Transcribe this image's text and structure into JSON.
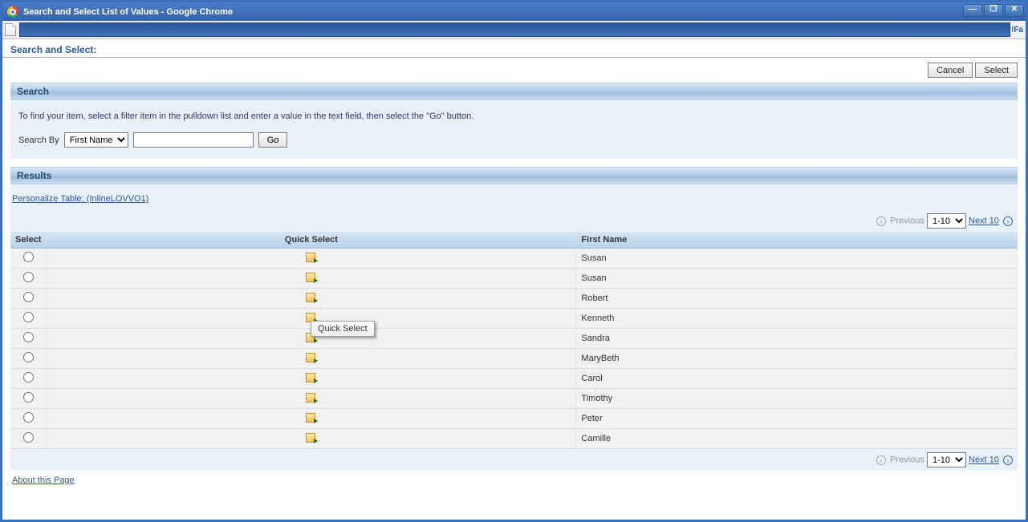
{
  "window": {
    "title": "Search and Select List of Values - Google Chrome",
    "addr_right": "!Fa"
  },
  "header": {
    "title": "Search and Select:"
  },
  "actions": {
    "cancel": "Cancel",
    "select": "Select"
  },
  "search": {
    "section_title": "Search",
    "help": "To find your item, select a filter item in the pulldown list and enter a value in the text field, then select the \"Go\" button.",
    "by_label": "Search By",
    "by_value": "First Name",
    "input_value": "",
    "go": "Go"
  },
  "results": {
    "section_title": "Results",
    "personalize": "Personalize Table: (InlineLOVVO1)",
    "columns": {
      "select": "Select",
      "quick_select": "Quick Select",
      "first_name": "First Name"
    },
    "tooltip": "Quick Select",
    "rows": [
      {
        "first_name": "Susan"
      },
      {
        "first_name": "Susan"
      },
      {
        "first_name": "Robert"
      },
      {
        "first_name": "Kenneth"
      },
      {
        "first_name": "Sandra"
      },
      {
        "first_name": "MaryBeth"
      },
      {
        "first_name": "Carol"
      },
      {
        "first_name": "Timothy"
      },
      {
        "first_name": "Peter"
      },
      {
        "first_name": "Camille"
      }
    ]
  },
  "pager": {
    "previous": "Previous",
    "range": "1-10",
    "next": "Next 10"
  },
  "footer": {
    "about": "About this Page"
  }
}
